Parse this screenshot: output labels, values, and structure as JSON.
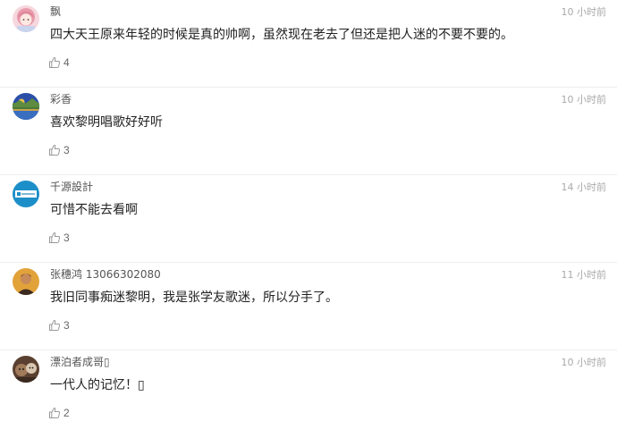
{
  "comments": [
    {
      "username": "飘",
      "time": "10 小时前",
      "content": "四大天王原来年轻的时候是真的帅啊，虽然现在老去了但还是把人迷的不要不要的。",
      "likes": "4",
      "avatar_icon": "pink-hair-girl-avatar"
    },
    {
      "username": "彩香",
      "time": "10 小时前",
      "content": "喜欢黎明唱歌好好听",
      "likes": "3",
      "avatar_icon": "landscape-avatar"
    },
    {
      "username": "千源設計",
      "time": "14 小时前",
      "content": "可惜不能去看啊",
      "likes": "3",
      "avatar_icon": "logo-avatar"
    },
    {
      "username": "张穗鸿 13066302080",
      "time": "11 小时前",
      "content": "我旧同事痴迷黎明，我是张学友歌迷，所以分手了。",
      "likes": "3",
      "avatar_icon": "portrait-avatar"
    },
    {
      "username": "漂泊者成哥▯",
      "time": "10 小时前",
      "content": "一代人的记忆！▯",
      "likes": "2",
      "avatar_icon": "animals-avatar"
    }
  ],
  "colors": {
    "username": "#555555",
    "time": "#aaaaaa",
    "content": "#222222",
    "like_icon": "#999999"
  }
}
